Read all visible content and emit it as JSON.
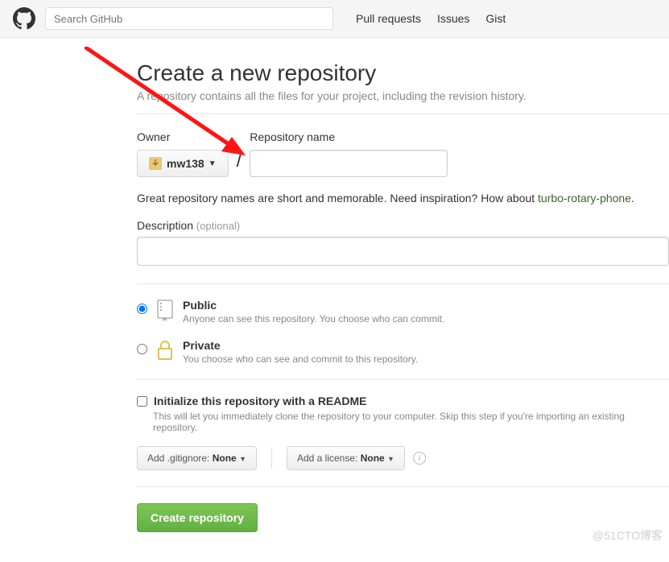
{
  "header": {
    "search_placeholder": "Search GitHub",
    "nav": [
      "Pull requests",
      "Issues",
      "Gist"
    ]
  },
  "page": {
    "title": "Create a new repository",
    "subtitle": "A repository contains all the files for your project, including the revision history."
  },
  "owner": {
    "label": "Owner",
    "name": "mw138"
  },
  "repo": {
    "label": "Repository name"
  },
  "hint": {
    "prefix": "Great repository names are short and memorable. Need inspiration? How about ",
    "suggestion": "turbo-rotary-phone",
    "suffix": "."
  },
  "description": {
    "label": "Description",
    "optional": "(optional)"
  },
  "visibility": {
    "public": {
      "title": "Public",
      "desc": "Anyone can see this repository. You choose who can commit."
    },
    "private": {
      "title": "Private",
      "desc": "You choose who can see and commit to this repository."
    }
  },
  "readme": {
    "title": "Initialize this repository with a README",
    "desc": "This will let you immediately clone the repository to your computer. Skip this step if you're importing an existing repository."
  },
  "options": {
    "gitignore_prefix": "Add .gitignore: ",
    "gitignore_value": "None",
    "license_prefix": "Add a license: ",
    "license_value": "None"
  },
  "submit": "Create repository",
  "watermark": "@51CTO博客"
}
